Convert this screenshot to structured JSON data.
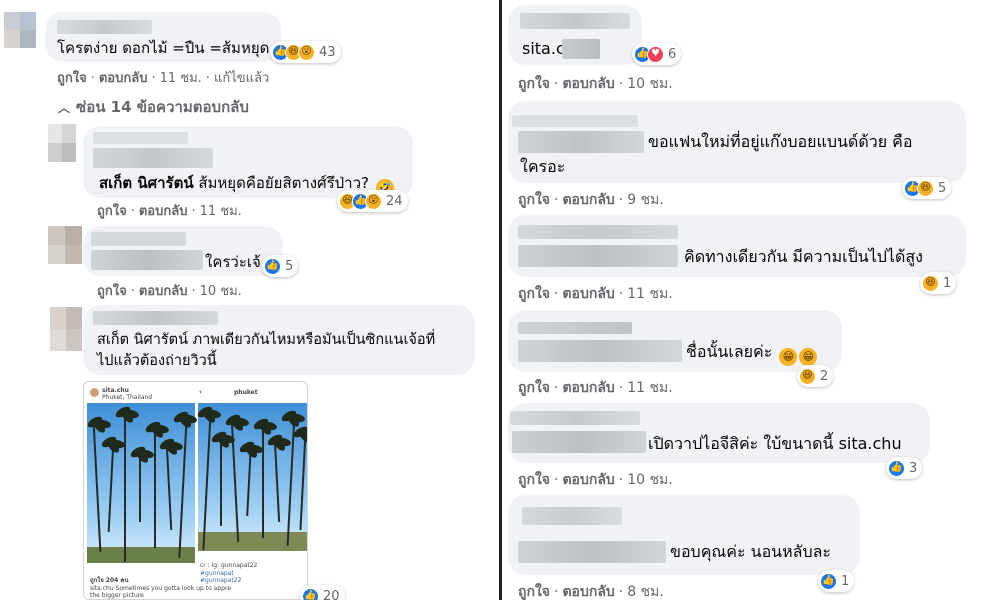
{
  "left": {
    "comment1": {
      "text": "โครตง่าย ดอกไม้ =ปืน =ส้มหยุด",
      "reaction_count": "43",
      "actions": {
        "like": "ถูกใจ",
        "reply": "ตอบกลับ",
        "time": "11 ชม.",
        "edited": "แก้ไขแล้ว"
      }
    },
    "hide_replies": "ซ่อน 14 ข้อความตอบกลับ",
    "reply1": {
      "tag": "สเก็ต นิศารัตน์",
      "text": "ส้มหยุดคือยัยสิตางศ์รึป่าว?",
      "reaction_count": "24",
      "actions": {
        "like": "ถูกใจ",
        "reply": "ตอบกลับ",
        "time": "11 ชม."
      }
    },
    "reply2": {
      "text": "ใครว่ะเจ้",
      "reaction_count": "5",
      "actions": {
        "like": "ถูกใจ",
        "reply": "ตอบกลับ",
        "time": "10 ชม."
      }
    },
    "reply3": {
      "line1": "สเก็ต นิศารัตน์ ภาพเดียวกันไหมหรือมันเป็นซิกแนเจ้อที่",
      "line2": "ไปแล้วต้องถ่ายวิวนี้",
      "reaction_count": "20",
      "image": {
        "username": "sita.chu",
        "location": "Phuket, Thailand",
        "likes": "ถูกใจ 204 คน",
        "caption": "sita.chu Sometimes you gotta look up to appre",
        "caption2": "the bigger picture",
        "right_title": "phuket",
        "right_by": "cr : ig: gunnapat22",
        "right_tag1": "#gunnapat",
        "right_tag2": "#gunnapat22"
      }
    }
  },
  "right": {
    "c1": {
      "text": "sita.c",
      "reaction_count": "6",
      "actions": {
        "like": "ถูกใจ",
        "reply": "ตอบกลับ",
        "time": "10 ชม."
      }
    },
    "c2": {
      "line1": "ขอแฟนใหม่ที่อยู่แก๊งบอยแบนด์ด้วย คือ",
      "line2": "ใครอะ",
      "reaction_count": "5",
      "actions": {
        "like": "ถูกใจ",
        "reply": "ตอบกลับ",
        "time": "9 ชม."
      }
    },
    "c3": {
      "text": "คิดทางเดียวกัน มีความเป็นไปได้สูง",
      "reaction_count": "1",
      "actions": {
        "like": "ถูกใจ",
        "reply": "ตอบกลับ",
        "time": "11 ชม."
      }
    },
    "c4": {
      "text": "ชื่อนั้นเลยค่ะ",
      "reaction_count": "2",
      "actions": {
        "like": "ถูกใจ",
        "reply": "ตอบกลับ",
        "time": "11 ชม."
      }
    },
    "c5": {
      "text": "เปิดวาปไอจีสิค่ะ ใบ้ขนาดนี้ sita.chu",
      "reaction_count": "3",
      "actions": {
        "like": "ถูกใจ",
        "reply": "ตอบกลับ",
        "time": "10 ชม."
      }
    },
    "c6": {
      "text": "ขอบคุณค่ะ นอนหลับละ",
      "reaction_count": "1",
      "actions": {
        "like": "ถูกใจ",
        "reply": "ตอบกลับ",
        "time": "8 ชม."
      }
    }
  },
  "colors": {
    "bubble": "#f0f2f5",
    "meta_text": "#65676b",
    "like_blue": "#1877f2",
    "haha_yellow": "#f7b125",
    "love_red": "#f33e58",
    "divider": "#1c1e21"
  },
  "icons": [
    "like-reaction-icon",
    "haha-reaction-icon",
    "wow-reaction-icon",
    "love-reaction-icon",
    "chevron-up-icon",
    "laughing-emoji-icon",
    "grinning-emoji-icon"
  ]
}
